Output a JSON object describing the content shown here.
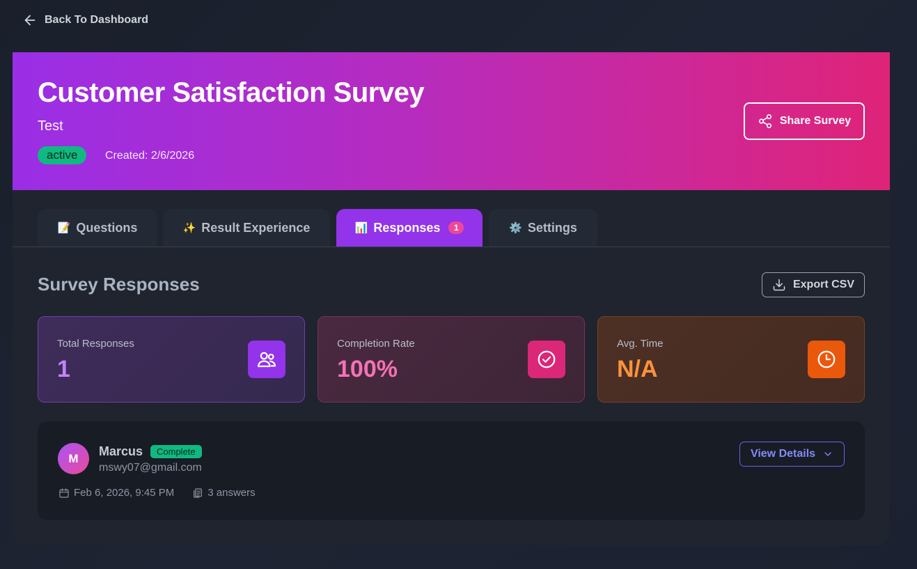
{
  "nav": {
    "back_label": "Back To Dashboard"
  },
  "survey": {
    "title": "Customer Satisfaction Survey",
    "subtitle": "Test",
    "status": "active",
    "created": "Created: 2/6/2026",
    "share_label": "Share Survey"
  },
  "tabs": [
    {
      "emoji": "📝",
      "label": "Questions"
    },
    {
      "emoji": "✨",
      "label": "Result Experience"
    },
    {
      "emoji": "📊",
      "label": "Responses",
      "badge": "1",
      "active": true
    },
    {
      "emoji": "⚙️",
      "label": "Settings"
    }
  ],
  "responses_section": {
    "title": "Survey Responses",
    "export_label": "Export CSV",
    "stats": [
      {
        "label": "Total Responses",
        "value": "1",
        "icon": "users-icon"
      },
      {
        "label": "Completion Rate",
        "value": "100%",
        "icon": "check-circle-icon"
      },
      {
        "label": "Avg. Time",
        "value": "N/A",
        "icon": "clock-icon"
      }
    ],
    "items": [
      {
        "initial": "M",
        "name": "Marcus",
        "status": "Complete",
        "email": "mswy07@gmail.com",
        "date": "Feb 6, 2026, 9:45 PM",
        "answers": "3 answers",
        "view_label": "View Details"
      }
    ]
  },
  "colors": {
    "accent_purple": "#9333ea",
    "accent_pink": "#db2777",
    "accent_orange": "#ea580c",
    "status_green": "#10b981",
    "link_indigo": "#818cf8"
  }
}
